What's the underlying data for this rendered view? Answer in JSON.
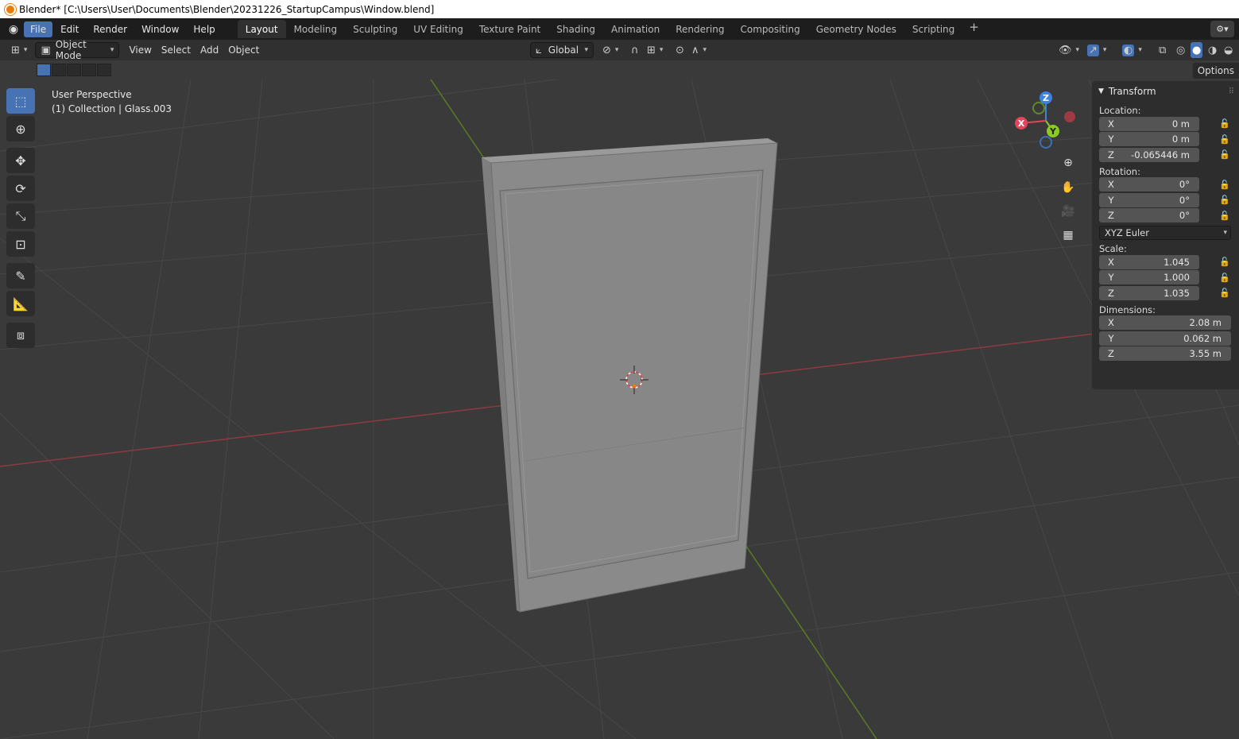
{
  "titlebar": {
    "text": "Blender* [C:\\Users\\User\\Documents\\Blender\\20231226_StartupCampus\\Window.blend]"
  },
  "menu": {
    "items": [
      "File",
      "Edit",
      "Render",
      "Window",
      "Help"
    ]
  },
  "workspaces": [
    "Layout",
    "Modeling",
    "Sculpting",
    "UV Editing",
    "Texture Paint",
    "Shading",
    "Animation",
    "Rendering",
    "Compositing",
    "Geometry Nodes",
    "Scripting"
  ],
  "header": {
    "mode": "Object Mode",
    "menus": [
      "View",
      "Select",
      "Add",
      "Object"
    ],
    "orientation": "Global"
  },
  "options_label": "Options",
  "viewport": {
    "perspective": "User Perspective",
    "collection": "(1) Collection | Glass.003"
  },
  "gizmo": {
    "z": "Z",
    "y": "Y",
    "x": "X"
  },
  "npanel": {
    "title": "Transform",
    "location_label": "Location:",
    "location": [
      {
        "axis": "X",
        "value": "0 m"
      },
      {
        "axis": "Y",
        "value": "0 m"
      },
      {
        "axis": "Z",
        "value": "-0.065446 m"
      }
    ],
    "rotation_label": "Rotation:",
    "rotation": [
      {
        "axis": "X",
        "value": "0°"
      },
      {
        "axis": "Y",
        "value": "0°"
      },
      {
        "axis": "Z",
        "value": "0°"
      }
    ],
    "rotation_mode": "XYZ Euler",
    "scale_label": "Scale:",
    "scale": [
      {
        "axis": "X",
        "value": "1.045"
      },
      {
        "axis": "Y",
        "value": "1.000"
      },
      {
        "axis": "Z",
        "value": "1.035"
      }
    ],
    "dimensions_label": "Dimensions:",
    "dimensions": [
      {
        "axis": "X",
        "value": "2.08 m"
      },
      {
        "axis": "Y",
        "value": "0.062 m"
      },
      {
        "axis": "Z",
        "value": "3.55 m"
      }
    ]
  },
  "colors": {
    "accent": "#4772b3",
    "x_axis": "#e3455b",
    "y_axis": "#8ac926",
    "z_axis": "#3d82e0",
    "object": "#8a8a8a"
  }
}
